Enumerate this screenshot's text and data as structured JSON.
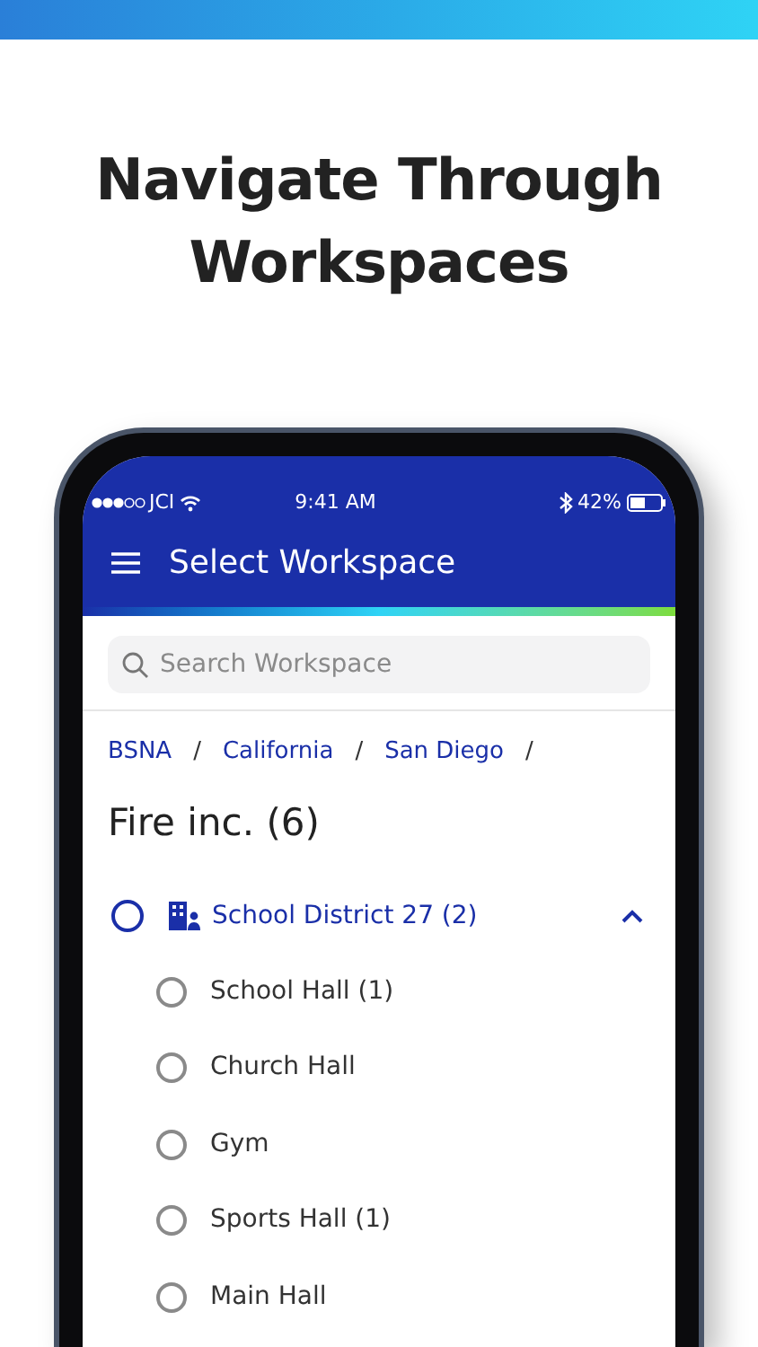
{
  "headline": "Navigate Through Workspaces",
  "status_bar": {
    "carrier": "JCI",
    "time": "9:41 AM",
    "battery": "42%"
  },
  "app_bar": {
    "title": "Select Workspace"
  },
  "search": {
    "placeholder": "Search Workspace"
  },
  "breadcrumbs": [
    "BSNA",
    "California",
    "San Diego"
  ],
  "separator": "/",
  "heading": "Fire inc. (6)",
  "tree": [
    {
      "label": "School District 27 (2)",
      "selected": false,
      "expanded": true,
      "children": [
        {
          "label": "School Hall (1)",
          "selected": false
        },
        {
          "label": "Church Hall",
          "selected": false
        },
        {
          "label": "Gym",
          "selected": false
        },
        {
          "label": "Sports Hall (1)",
          "selected": false
        },
        {
          "label": "Main Hall",
          "selected": false
        }
      ]
    }
  ]
}
